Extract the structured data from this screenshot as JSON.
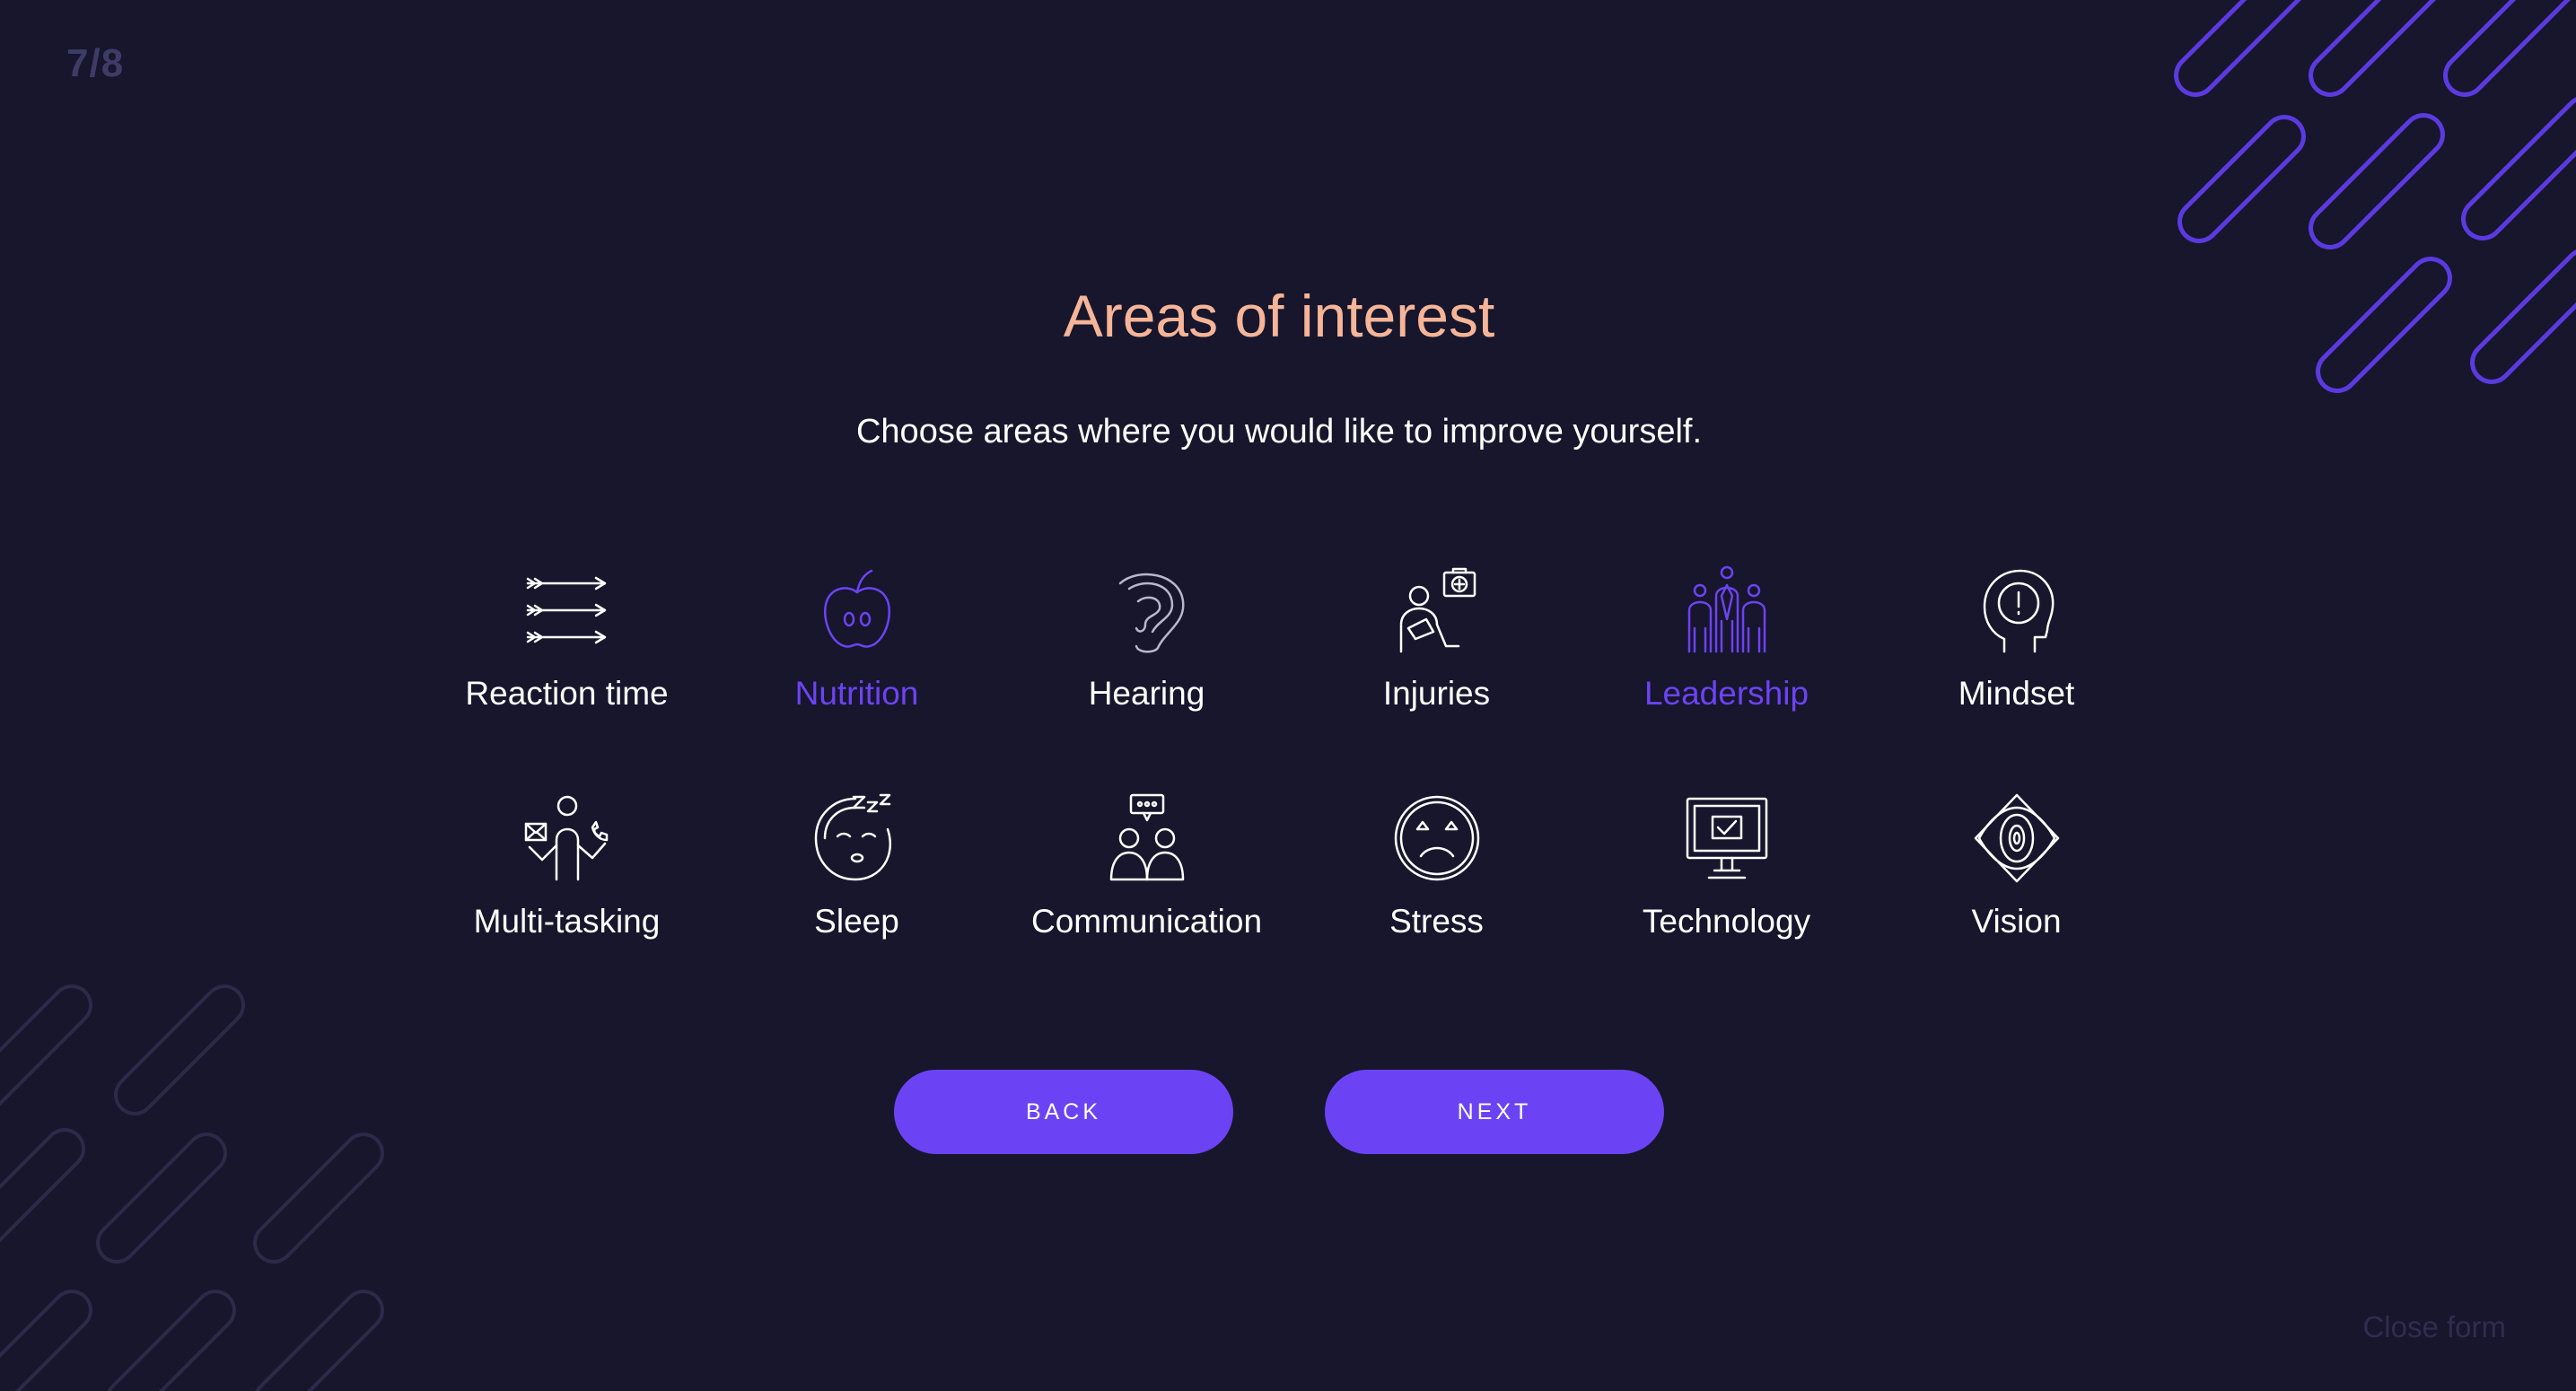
{
  "step": "7/8",
  "title": "Areas of interest",
  "subtitle": "Choose areas where you would like to improve yourself.",
  "areas": [
    {
      "label": "Reaction time",
      "icon": "arrows-icon",
      "selected": false
    },
    {
      "label": "Nutrition",
      "icon": "apple-icon",
      "selected": true
    },
    {
      "label": "Hearing",
      "icon": "ear-icon",
      "selected": false
    },
    {
      "label": "Injuries",
      "icon": "injury-icon",
      "selected": false
    },
    {
      "label": "Leadership",
      "icon": "team-icon",
      "selected": true
    },
    {
      "label": "Mindset",
      "icon": "head-exclamation-icon",
      "selected": false
    },
    {
      "label": "Multi-tasking",
      "icon": "multitasking-person-icon",
      "selected": false
    },
    {
      "label": "Sleep",
      "icon": "sleep-face-icon",
      "selected": false
    },
    {
      "label": "Communication",
      "icon": "people-chat-icon",
      "selected": false
    },
    {
      "label": "Stress",
      "icon": "stressed-face-icon",
      "selected": false
    },
    {
      "label": "Technology",
      "icon": "monitor-check-icon",
      "selected": false
    },
    {
      "label": "Vision",
      "icon": "eye-icon",
      "selected": false
    }
  ],
  "buttons": {
    "back": "BACK",
    "next": "NEXT"
  },
  "close": "Close form",
  "colors": {
    "background": "#17162c",
    "accent": "#6c43f4",
    "title": "#f6b598",
    "muted": "#3e3c66",
    "deco": "#5b3ae0"
  }
}
